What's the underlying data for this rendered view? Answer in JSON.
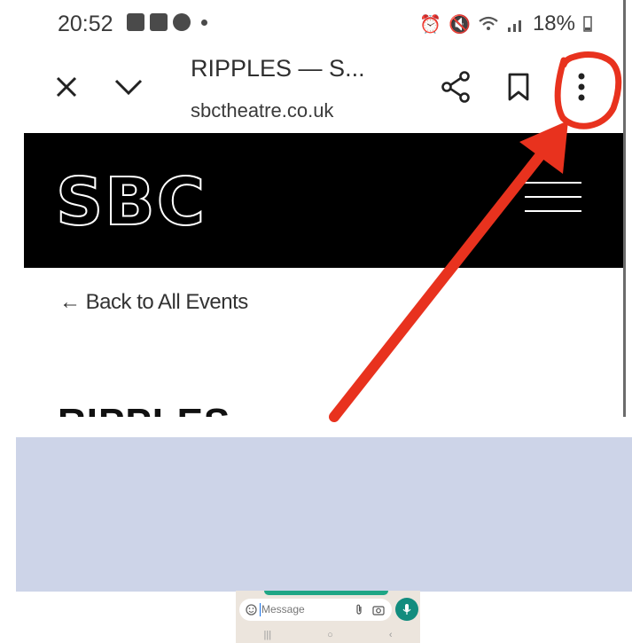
{
  "status_bar": {
    "time": "20:52",
    "left_icons": [
      "gallery-icon",
      "app-notification-icon",
      "alert-icon"
    ],
    "right_icons": [
      "alarm-icon",
      "mute-icon",
      "wifi-icon",
      "signal-icon"
    ],
    "battery": "18%"
  },
  "browser_toolbar": {
    "page_title": "RIPPLES — S...",
    "url": "sbctheatre.co.uk"
  },
  "site_header": {
    "logo": "SBC"
  },
  "content": {
    "back_link": "← Back to All Events",
    "heading_partial": "RIPPLES"
  },
  "compose_bar": {
    "placeholder": "Message"
  },
  "colors": {
    "annotation": "#e8321e",
    "header_bg": "#000000",
    "panel_bg": "#cdd4e8",
    "chat_accent": "#128c7e"
  }
}
